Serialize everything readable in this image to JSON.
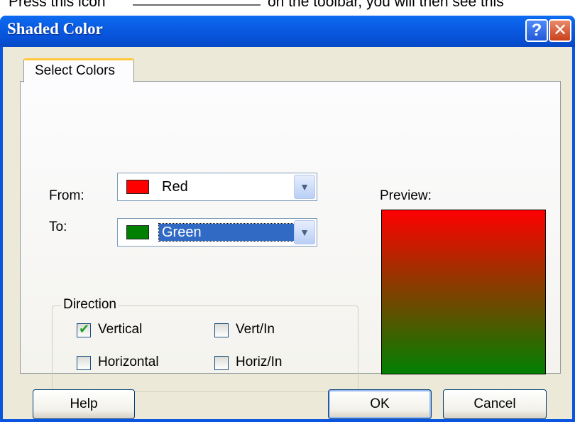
{
  "top_text": {
    "before": "Press this icon",
    "after": "on the toolbar, you will then see this"
  },
  "window": {
    "title": "Shaded Color",
    "help_glyph": "?",
    "close_glyph": "✕"
  },
  "tab": {
    "label": "Select Colors"
  },
  "from": {
    "label": "From:",
    "value": "Red",
    "color": "#ff0000"
  },
  "to": {
    "label": "To:",
    "value": "Green",
    "color": "#008000"
  },
  "preview": {
    "label": "Preview:"
  },
  "direction": {
    "label": "Direction",
    "options": [
      {
        "label": "Vertical",
        "checked": true
      },
      {
        "label": "Vert/In",
        "checked": false
      },
      {
        "label": "Horizontal",
        "checked": false
      },
      {
        "label": "Horiz/In",
        "checked": false
      }
    ]
  },
  "buttons": {
    "help": "Help",
    "ok": "OK",
    "cancel": "Cancel"
  }
}
